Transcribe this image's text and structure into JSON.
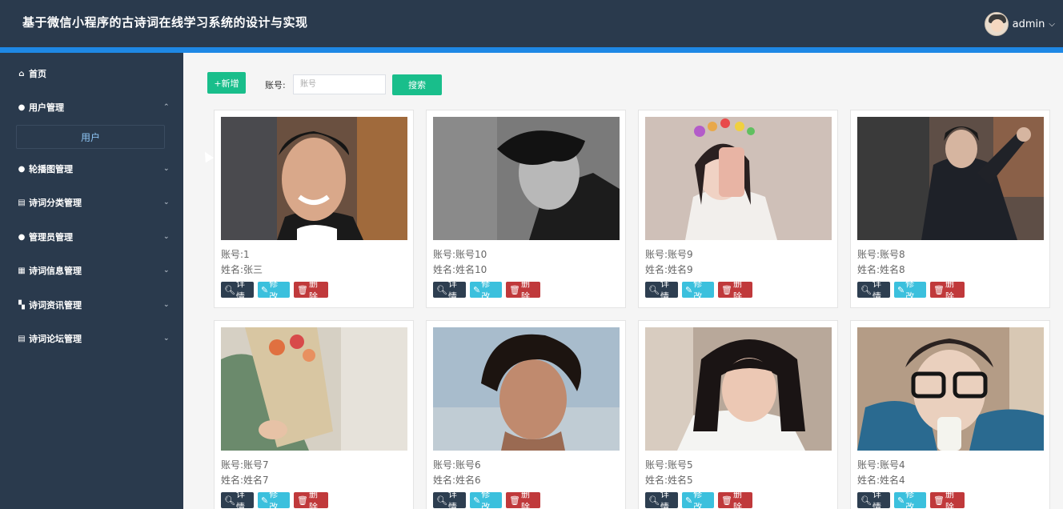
{
  "header": {
    "title": "基于微信小程序的古诗词在线学习系统的设计与实现",
    "user_name": "admin",
    "user_chevron": "⌵"
  },
  "sidebar": {
    "items": [
      {
        "icon": "⌂",
        "icon_name": "home-icon",
        "label": "首页",
        "arrow": ""
      },
      {
        "icon": "●",
        "icon_name": "user-icon",
        "label": "用户管理",
        "arrow": "⌃"
      },
      {
        "icon": "●",
        "icon_name": "carousel-icon",
        "label": "轮播图管理",
        "arrow": "⌄"
      },
      {
        "icon": "▤",
        "icon_name": "category-icon",
        "label": "诗词分类管理",
        "arrow": "⌄"
      },
      {
        "icon": "●",
        "icon_name": "admin-icon",
        "label": "管理员管理",
        "arrow": "⌄"
      },
      {
        "icon": "▦",
        "icon_name": "grid-icon",
        "label": "诗词信息管理",
        "arrow": "⌄"
      },
      {
        "icon": "▚",
        "icon_name": "news-icon",
        "label": "诗词资讯管理",
        "arrow": "⌄"
      },
      {
        "icon": "▤",
        "icon_name": "forum-icon",
        "label": "诗词论坛管理",
        "arrow": "⌄"
      }
    ],
    "sub_item": "用户"
  },
  "toolbar": {
    "add_label": "+新增",
    "search_label": "账号:",
    "search_placeholder": "账号",
    "search_button": "搜索"
  },
  "buttons": {
    "detail": "详情",
    "edit": "修改",
    "delete": "删除"
  },
  "cards": [
    {
      "account": "账号:1",
      "name": "姓名:张三"
    },
    {
      "account": "账号:账号10",
      "name": "姓名:姓名10"
    },
    {
      "account": "账号:账号9",
      "name": "姓名:姓名9"
    },
    {
      "account": "账号:账号8",
      "name": "姓名:姓名8"
    },
    {
      "account": "账号:账号7",
      "name": "姓名:姓名7"
    },
    {
      "account": "账号:账号6",
      "name": "姓名:姓名6"
    },
    {
      "account": "账号:账号5",
      "name": "姓名:姓名5"
    },
    {
      "account": "账号:账号4",
      "name": "姓名:姓名4"
    }
  ],
  "colors": {
    "header_bg": "#2a3a4d",
    "accent_stripe": "#1e88e5",
    "primary_green": "#19be8b",
    "detail_btn": "#2d3e50",
    "edit_btn": "#3bc0dd",
    "delete_btn": "#c0393b"
  }
}
